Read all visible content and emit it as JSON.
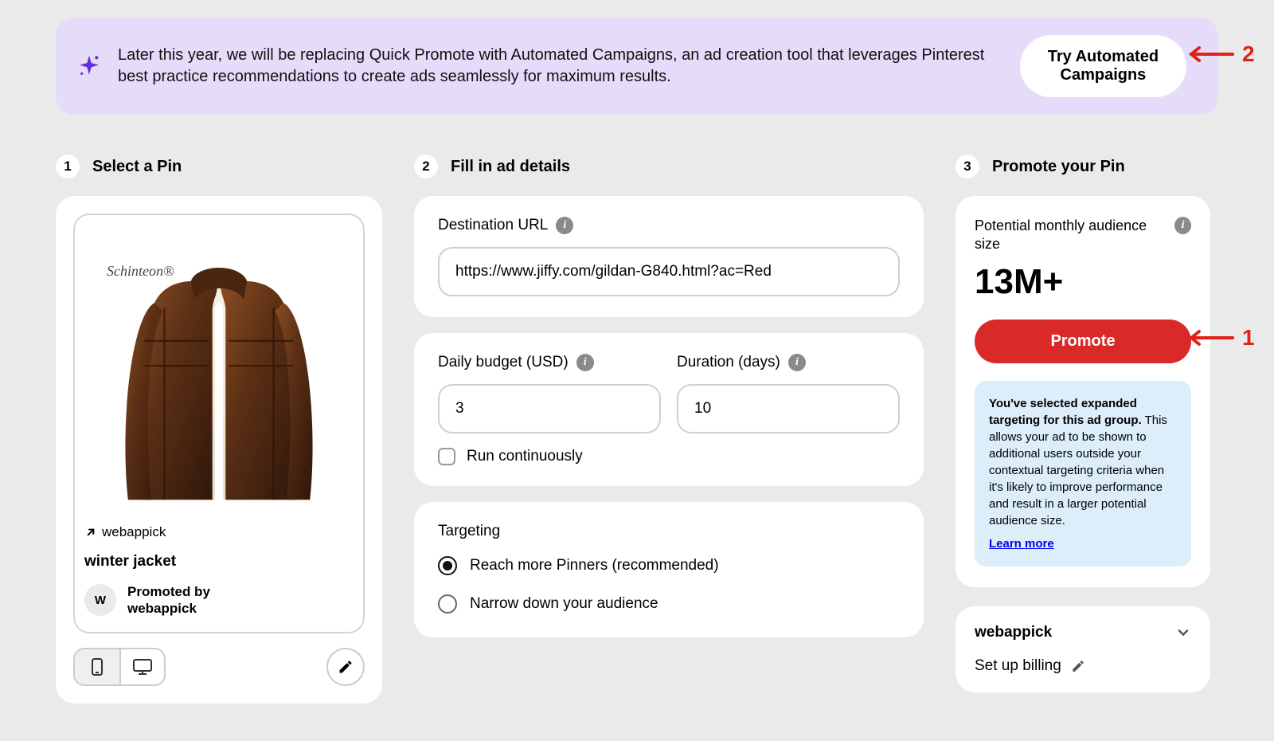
{
  "banner": {
    "message": "Later this year, we will be replacing Quick Promote with Automated Campaigns, an ad creation tool that leverages Pinterest best practice recommendations to create ads seamlessly for maximum results.",
    "cta": "Try Automated Campaigns"
  },
  "steps": {
    "step1": {
      "number": "1",
      "title": "Select a Pin"
    },
    "step2": {
      "number": "2",
      "title": "Fill in ad details"
    },
    "step3": {
      "number": "3",
      "title": "Promote your Pin"
    }
  },
  "pin": {
    "brand": "Schinteon®",
    "domain": "webappick",
    "title": "winter jacket",
    "avatar_initial": "W",
    "promoted_by_label": "Promoted by",
    "promoted_by_name": "webappick"
  },
  "form": {
    "destination_label": "Destination URL",
    "destination_value": "https://www.jiffy.com/gildan-G840.html?ac=Red",
    "budget_label": "Daily budget (USD)",
    "budget_value": "3",
    "duration_label": "Duration (days)",
    "duration_value": "10",
    "run_continuously": "Run continuously",
    "targeting_title": "Targeting",
    "targeting_option1": "Reach more Pinners (recommended)",
    "targeting_option2": "Narrow down your audience",
    "targeting_selected": 0
  },
  "promote": {
    "audience_label": "Potential monthly audience size",
    "audience_value": "13M+",
    "button": "Promote",
    "notice_bold": "You've selected expanded targeting for this ad group.",
    "notice_rest": " This allows your ad to be shown to additional users outside your contextual targeting criteria when it's likely to improve performance and result in a larger potential audience size.",
    "learn_more": "Learn more"
  },
  "billing": {
    "account": "webappick",
    "setup": "Set up billing"
  },
  "annotations": {
    "pointer1": "1",
    "pointer2": "2"
  }
}
